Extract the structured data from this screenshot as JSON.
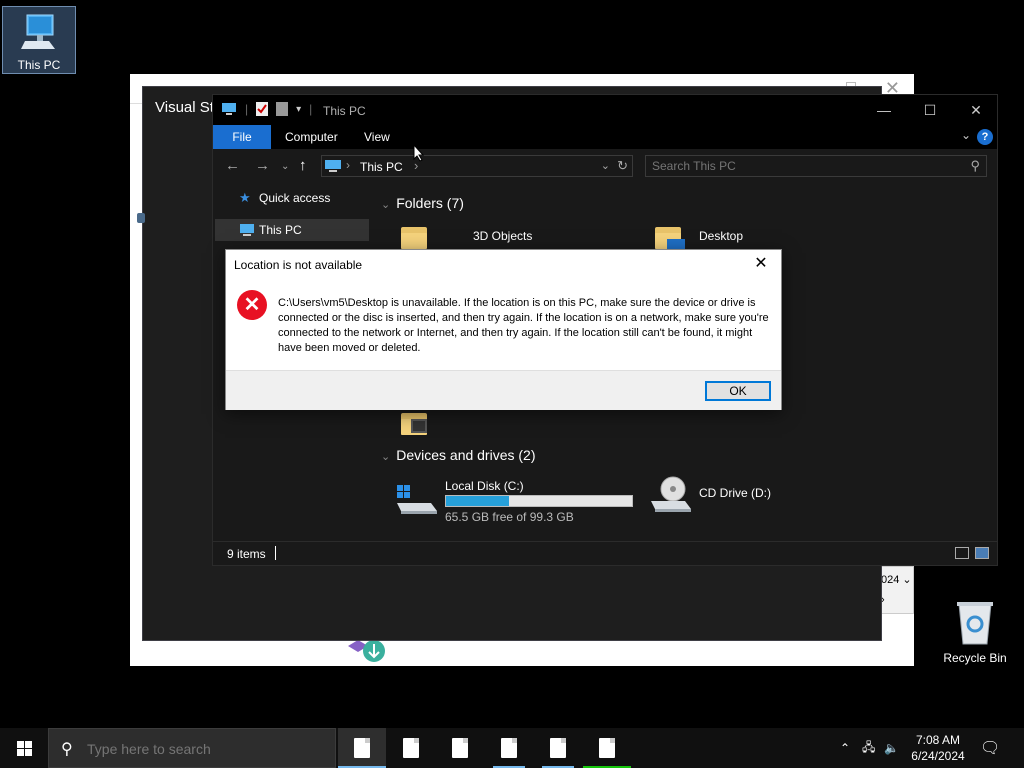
{
  "desktop": {
    "this_pc_label": "This PC",
    "recycle_bin_label": "Recycle Bin"
  },
  "background_app": {
    "title": "Visual St",
    "dropdown_text": "024"
  },
  "explorer": {
    "title": "This PC",
    "ribbon_tabs": [
      "File",
      "Computer",
      "View"
    ],
    "help_label": "?",
    "address": "This PC",
    "search_placeholder": "Search This PC",
    "nav_items": [
      {
        "label": "Quick access",
        "icon": "star-icon"
      },
      {
        "label": "This PC",
        "icon": "computer-icon",
        "selected": true
      }
    ],
    "folders_header": "Folders (7)",
    "folders": [
      {
        "label": "3D Objects"
      },
      {
        "label": "Desktop"
      }
    ],
    "drives_header": "Devices and drives (2)",
    "drives": [
      {
        "label": "Local Disk (C:)",
        "free_text": "65.5 GB free of 99.3 GB",
        "used_fraction": 0.34
      },
      {
        "label": "CD Drive (D:)"
      }
    ],
    "status_items": "9 items"
  },
  "dialog": {
    "title": "Location is not available",
    "message": "C:\\Users\\vm5\\Desktop is unavailable. If the location is on this PC, make sure the device or drive is connected or the disc is inserted, and then try again. If the location is on a network, make sure you're connected to the network or Internet, and then try again. If the location still can't be found, it might have been moved or deleted.",
    "ok_label": "OK",
    "icon": "error-icon"
  },
  "taskbar": {
    "search_placeholder": "Type here to search",
    "time": "7:08 AM",
    "date": "6/24/2024"
  },
  "colors": {
    "accent": "#1a6ed0",
    "error": "#e81123",
    "drive_fill": "#26a0da"
  }
}
